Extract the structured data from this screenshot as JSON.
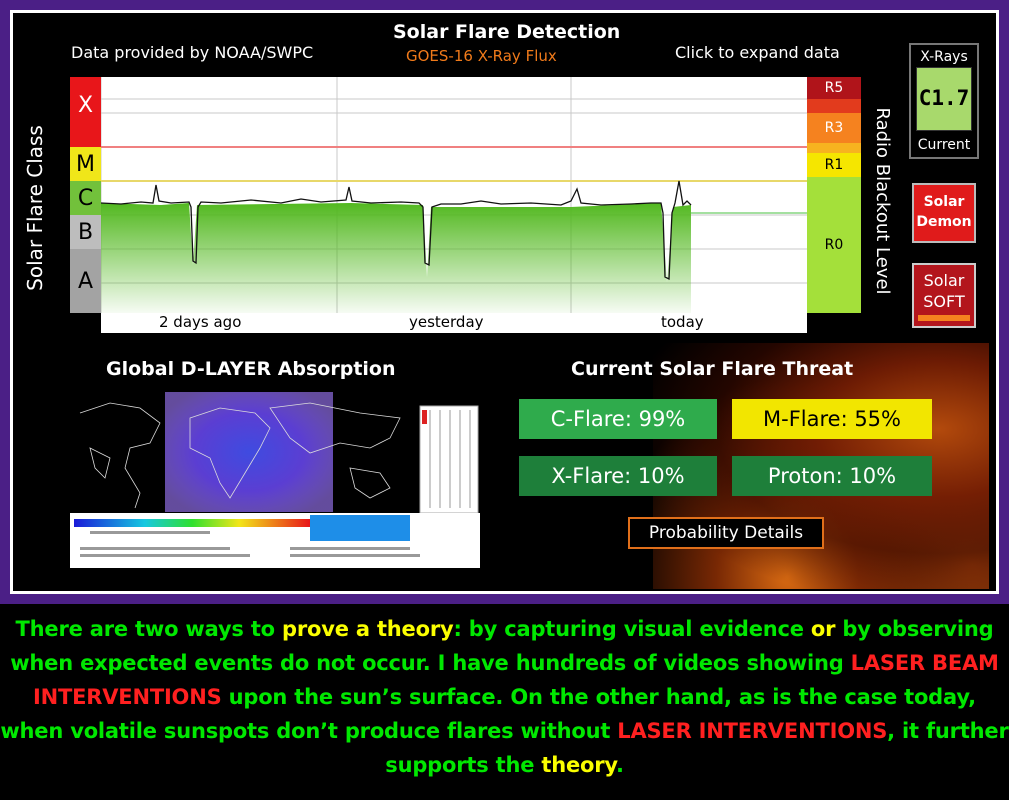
{
  "header": {
    "title": "Solar Flare Detection",
    "credit": "Data provided by NOAA/SWPC",
    "source": "GOES-16 X-Ray Flux",
    "expand_link": "Click to expand data"
  },
  "chart": {
    "left_axis_label": "Solar Flare Class",
    "right_axis_label": "Radio Blackout Level",
    "flare_classes": [
      "X",
      "M",
      "C",
      "B",
      "A"
    ],
    "blackout_levels": [
      "R5",
      "R3",
      "R1",
      "R0"
    ],
    "x_ticks": [
      "2 days ago",
      "yesterday",
      "today"
    ]
  },
  "xray_widget": {
    "label": "X-Rays",
    "value": "C1.7",
    "status": "Current"
  },
  "buttons": {
    "solar_demon": "Solar\nDemon",
    "solar_soft_1": "Solar",
    "solar_soft_2": "SOFT",
    "probability_details": "Probability Details"
  },
  "dlayer": {
    "title": "Global D-LAYER Absorption"
  },
  "threat": {
    "title": "Current Solar Flare Threat",
    "c_flare": "C-Flare: 99%",
    "m_flare": "M-Flare: 55%",
    "x_flare": "X-Flare: 10%",
    "proton": "Proton: 10%"
  },
  "caption": {
    "p1": "There are two ways to ",
    "p2": "prove a theory",
    "p3": ": by capturing visual evidence ",
    "p4": "or",
    "p5": " by observing when expected events do not occur. I have hundreds of videos showing ",
    "p6": "LASER BEAM INTERVENTIONS",
    "p7": " upon the sun’s surface.  On the other hand, as is the case today, when volatile sunspots don’t produce flares without ",
    "p8": "LASER INTERVENTIONS",
    "p9": ", it further supports the ",
    "p10": "theory",
    "p11": "."
  },
  "colors": {
    "frame": "#4b1f86",
    "class_x": "#e8161a",
    "class_m": "#f0e619",
    "class_c": "#72c13b",
    "blackout_r5": "#b0141a",
    "blackout_r3": "#f5821f",
    "blackout_r1": "#f5e600",
    "blackout_r0": "#a4e03a",
    "caption_green": "#00e800",
    "caption_yellow": "#fbff00",
    "caption_red": "#ff2020"
  }
}
